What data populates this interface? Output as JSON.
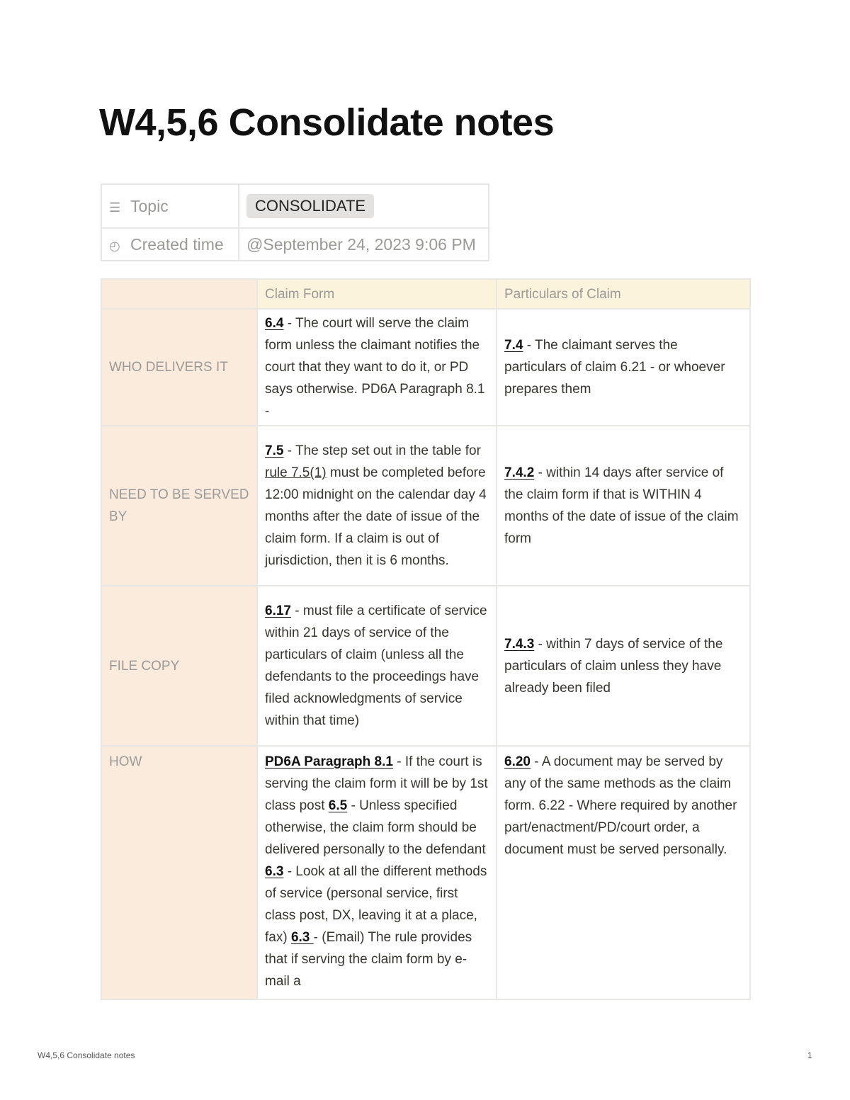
{
  "page": {
    "title": "W4,5,6 Consolidate notes"
  },
  "properties": [
    {
      "icon": "list-icon",
      "label": "Topic",
      "value": "CONSOLIDATE"
    },
    {
      "icon": "clock-icon",
      "label": "Created time",
      "value": "@September 24, 2023 9:06 PM"
    }
  ],
  "table": {
    "headers": [
      "",
      "Claim Form",
      "Particulars of Claim"
    ],
    "rows": [
      {
        "label": "WHO DELIVERS IT",
        "claim_form": [
          {
            "ref": "6.4"
          },
          {
            "text": " - The court will serve the claim form unless the claimant notifies the court that they want to do it, or PD says otherwise. PD6A Paragraph 8.1 -"
          }
        ],
        "particulars": [
          {
            "ref": "7.4"
          },
          {
            "text": " - The claimant serves the particulars of claim 6.21 - or whoever prepares them"
          }
        ]
      },
      {
        "label": "NEED TO BE SERVED BY",
        "claim_form": [
          {
            "ref": "7.5"
          },
          {
            "text": " - The step set out in the table for "
          },
          {
            "link": "rule 7.5(1)"
          },
          {
            "text": " must be completed before 12:00 midnight on the calendar day 4 months after the date of issue of the claim form. If a claim is out of jurisdiction, then it is 6 months."
          }
        ],
        "particulars": [
          {
            "ref": "7.4.2"
          },
          {
            "text": " - within 14 days after service of the claim form if that is WITHIN 4 months of the date of issue of the claim form"
          }
        ]
      },
      {
        "label": "FILE COPY",
        "claim_form": [
          {
            "ref": "6.17"
          },
          {
            "text": " - must file a certificate of service within 21 days of service of the particulars of claim (unless all the defendants to the proceedings have filed acknowledgments of service within that time)"
          }
        ],
        "particulars": [
          {
            "ref": "7.4.3"
          },
          {
            "text": " - within 7 days of service of the particulars of claim unless they have already been filed"
          }
        ]
      },
      {
        "label": "HOW",
        "claim_form": [
          {
            "ref": "PD6A Paragraph 8.1"
          },
          {
            "text": " - If the court is serving the claim form it will be by 1st class post "
          },
          {
            "ref": "6.5"
          },
          {
            "text": " - Unless specified otherwise, the claim form should be delivered personally to the defendant "
          },
          {
            "ref": "6.3"
          },
          {
            "text": " - Look at all the different methods of service (personal service, first class post, DX, leaving it at a place, fax) "
          },
          {
            "ref": "6.3 "
          },
          {
            "text": "- (Email) The rule provides that if serving the claim form by e-mail a"
          }
        ],
        "particulars": [
          {
            "ref": "6.20"
          },
          {
            "text": " - A document may be served by any of the same methods as the claim form. 6.22 - Where required by another part/enactment/PD/court order, a document must be served personally."
          }
        ]
      }
    ]
  },
  "footer": {
    "doc_title": "W4,5,6 Consolidate notes",
    "page_number": "1"
  },
  "colors": {
    "row_header_bg": "#faebdd",
    "column_header_bg": "#fbf3db",
    "tag_bg": "#e3e2e0"
  }
}
